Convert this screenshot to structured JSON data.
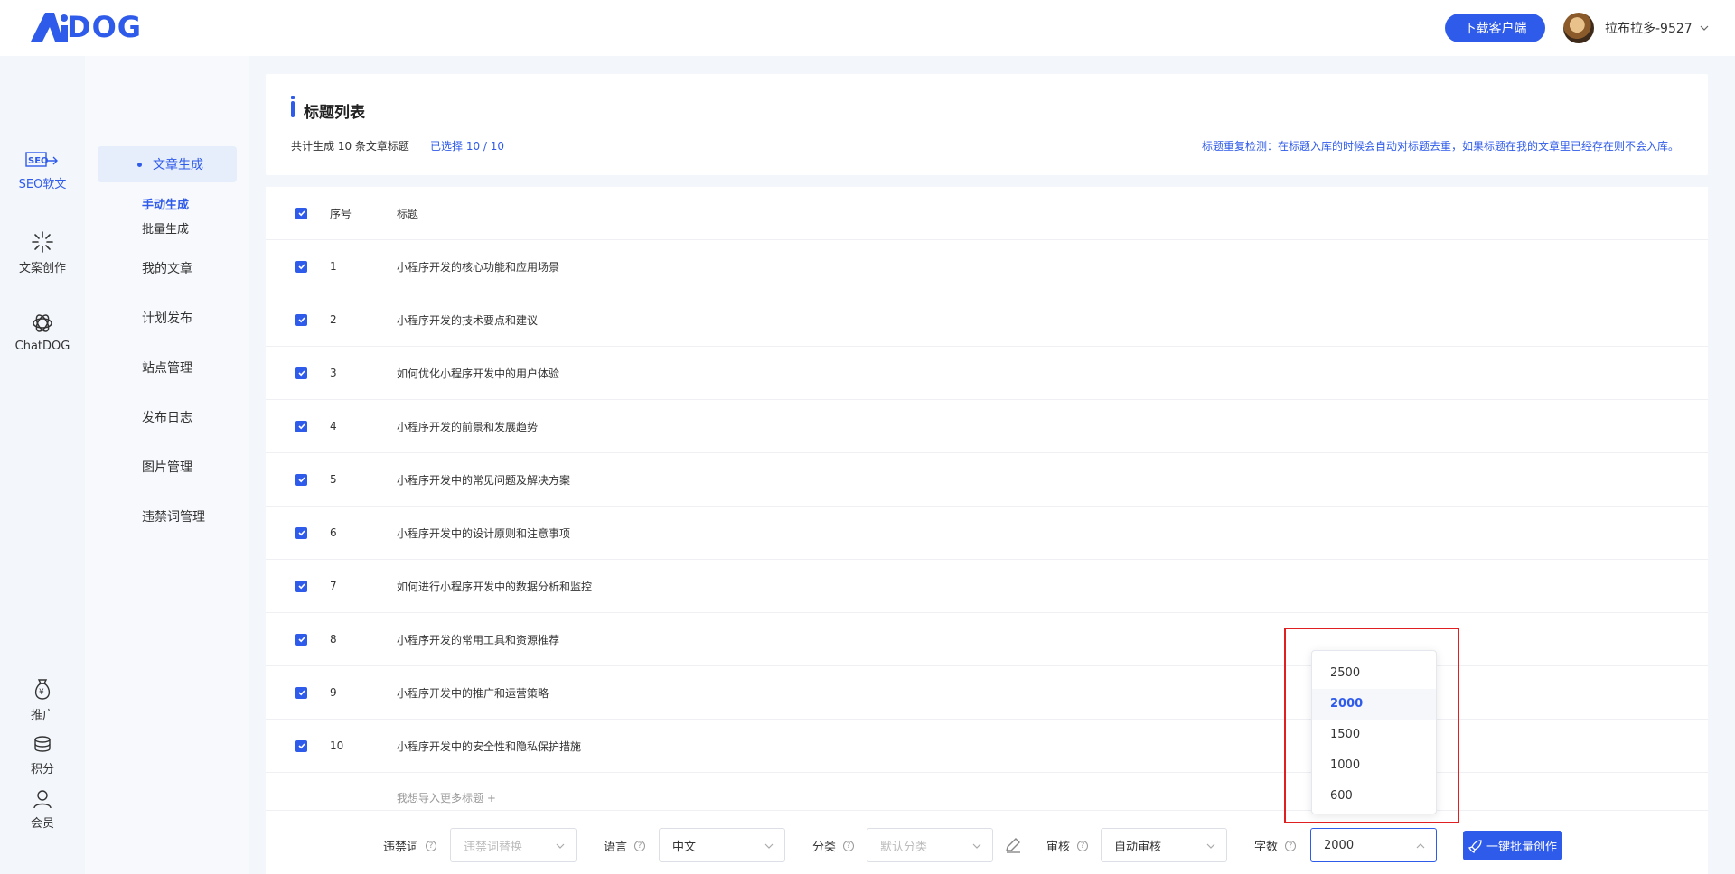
{
  "header": {
    "logo_text": "DOG",
    "logo_full": "AIDOG",
    "download_button": "下载客户端",
    "username": "拉布拉多-9527"
  },
  "rail": {
    "items": [
      {
        "label": "SEO软文",
        "icon": "seo-icon",
        "active": true
      },
      {
        "label": "文案创作",
        "icon": "sparkle-icon",
        "active": false
      },
      {
        "label": "ChatDOG",
        "icon": "openai-icon",
        "active": false
      },
      {
        "label": "推广",
        "icon": "money-bag-icon",
        "active": false
      },
      {
        "label": "积分",
        "icon": "coins-icon",
        "active": false
      },
      {
        "label": "会员",
        "icon": "user-icon",
        "active": false
      }
    ]
  },
  "sidebar": {
    "group_label": "文章生成",
    "sub_items": [
      "手动生成",
      "批量生成"
    ],
    "items": [
      "我的文章",
      "计划发布",
      "站点管理",
      "发布日志",
      "图片管理",
      "违禁词管理"
    ]
  },
  "title_card": {
    "title": "标题列表",
    "summary": "共计生成 10 条文章标题",
    "selected": "已选择 10 / 10",
    "note": "标题重复检测：在标题入库的时候会自动对标题去重，如果标题在我的文章里已经存在则不会入库。"
  },
  "table": {
    "columns": [
      "序号",
      "标题"
    ],
    "rows": [
      {
        "index": "1",
        "title": "小程序开发的核心功能和应用场景"
      },
      {
        "index": "2",
        "title": "小程序开发的技术要点和建议"
      },
      {
        "index": "3",
        "title": "如何优化小程序开发中的用户体验"
      },
      {
        "index": "4",
        "title": "小程序开发的前景和发展趋势"
      },
      {
        "index": "5",
        "title": "小程序开发中的常见问题及解决方案"
      },
      {
        "index": "6",
        "title": "小程序开发中的设计原则和注意事项"
      },
      {
        "index": "7",
        "title": "如何进行小程序开发中的数据分析和监控"
      },
      {
        "index": "8",
        "title": "小程序开发的常用工具和资源推荐"
      },
      {
        "index": "9",
        "title": "小程序开发中的推广和运营策略"
      },
      {
        "index": "10",
        "title": "小程序开发中的安全性和隐私保护措施"
      }
    ],
    "import_more": "我想导入更多标题 +"
  },
  "toolbar": {
    "banned_label": "违禁词",
    "banned_placeholder": "违禁词替换",
    "language_label": "语言",
    "language_value": "中文",
    "category_label": "分类",
    "category_placeholder": "默认分类",
    "review_label": "审核",
    "review_value": "自动审核",
    "wordcount_label": "字数",
    "wordcount_value": "2000",
    "batch_button": "一键批量创作"
  },
  "wordcount_dropdown": {
    "options": [
      "2500",
      "2000",
      "1500",
      "1000",
      "600"
    ],
    "selected": "2000"
  },
  "colors": {
    "accent": "#2f5bea",
    "highlight": "#e02020"
  }
}
